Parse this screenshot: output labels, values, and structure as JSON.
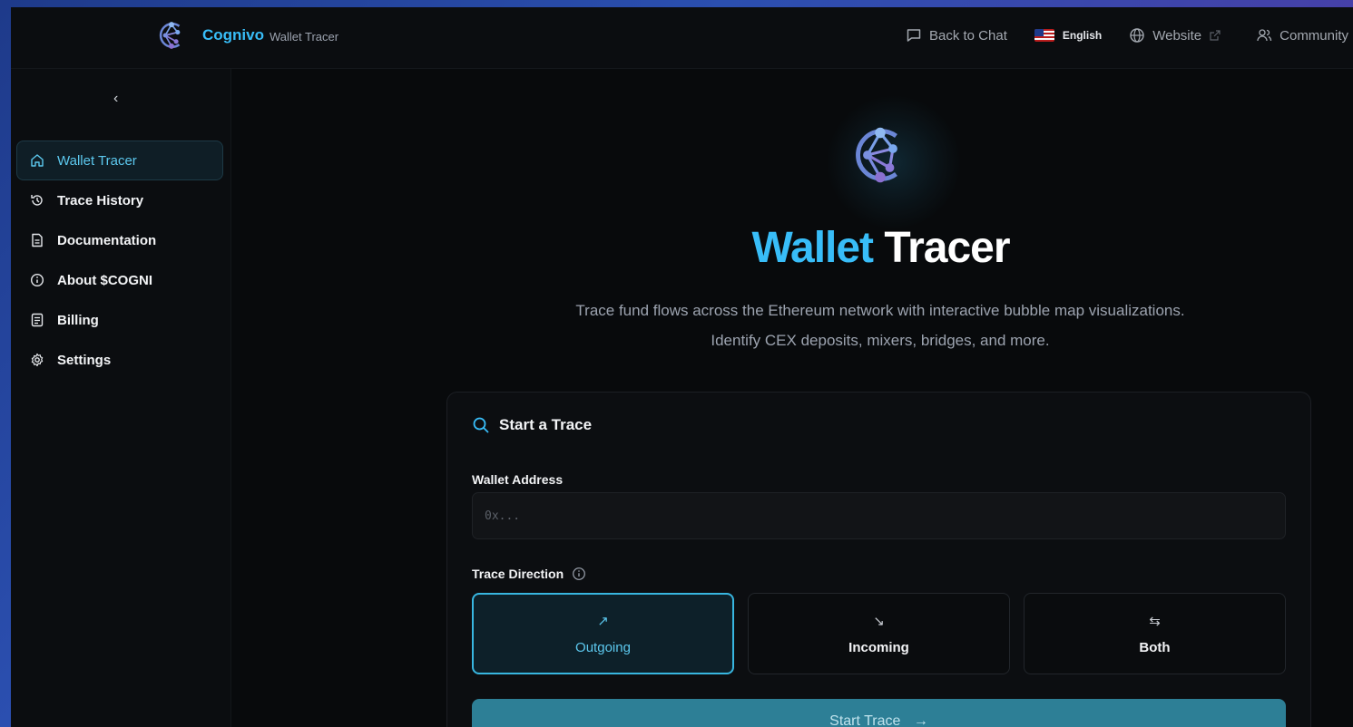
{
  "brand": {
    "name": "Cognivo",
    "subtitle": "Wallet Tracer",
    "icon": "cognivo-logo"
  },
  "topnav": {
    "back": {
      "label": "Back to Chat",
      "icon": "chat-icon"
    },
    "language": {
      "label": "English",
      "icon": "us-flag-icon"
    },
    "website": {
      "label": "Website",
      "icon": "globe-icon",
      "ext_icon": "external-link-icon"
    },
    "community": {
      "label": "Community",
      "icon": "users-icon"
    }
  },
  "sidebar": {
    "collapse_glyph": "‹",
    "items": [
      {
        "label": "Wallet Tracer",
        "icon": "home-icon",
        "active": true
      },
      {
        "label": "Trace History",
        "icon": "history-icon"
      },
      {
        "label": "Documentation",
        "icon": "document-icon"
      },
      {
        "label": "About $COGNI",
        "icon": "info-icon"
      },
      {
        "label": "Billing",
        "icon": "receipt-icon"
      },
      {
        "label": "Settings",
        "icon": "gear-icon"
      }
    ]
  },
  "hero": {
    "title_accent": "Wallet",
    "title_rest": "Tracer",
    "description": "Trace fund flows across the Ethereum network with interactive bubble map visualizations. Identify CEX deposits, mixers, bridges, and more."
  },
  "form": {
    "title": "Start a Trace",
    "address_label": "Wallet Address",
    "address_placeholder": "0x...",
    "address_value": "",
    "direction_label": "Trace Direction",
    "directions": [
      {
        "label": "Outgoing",
        "glyph": "↗",
        "selected": true
      },
      {
        "label": "Incoming",
        "glyph": "↘",
        "selected": false
      },
      {
        "label": "Both",
        "glyph": "⇆",
        "selected": false
      }
    ],
    "submit_label": "Start Trace",
    "submit_glyph": "→"
  },
  "colors": {
    "accent": "#38bdf8",
    "background": "#080a0c",
    "button": "#2d7f96"
  }
}
